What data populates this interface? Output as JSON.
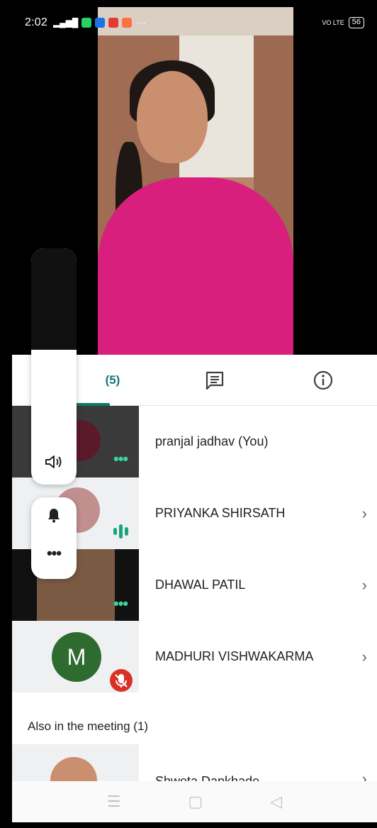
{
  "status_bar": {
    "time": "2:02",
    "network": "4G",
    "more": "···",
    "volte": "VO LTE",
    "battery": "56"
  },
  "tabs": {
    "people_count": "(5)",
    "chat_icon": "chat-icon",
    "info_icon": "info-icon",
    "accent_color": "#0b7a6e"
  },
  "participants": [
    {
      "name": "pranjal jadhav (You)",
      "status_icon": "more-dots-icon",
      "avatar_color": "#5a1a2a"
    },
    {
      "name": "PRIYANKA SHIRSATH",
      "status_icon": "audio-levels-icon"
    },
    {
      "name": "DHAWAL PATIL",
      "status_icon": "more-dots-icon"
    },
    {
      "name": "MADHURI VISHWAKARMA",
      "status_icon": "mic-off-icon",
      "avatar_letter": "M",
      "avatar_color": "#2e6b2f"
    }
  ],
  "also_in_meeting": {
    "heading": "Also in the meeting (1)",
    "items": [
      {
        "name": "Shweta Dankhade"
      }
    ]
  },
  "audio_controls": {
    "speaker_icon": "speaker-icon",
    "bell_icon": "bell-icon",
    "more_icon": "more-dots-icon"
  },
  "navbar": {
    "menu_icon": "menu-icon",
    "home_icon": "home-icon",
    "back_icon": "back-icon"
  }
}
